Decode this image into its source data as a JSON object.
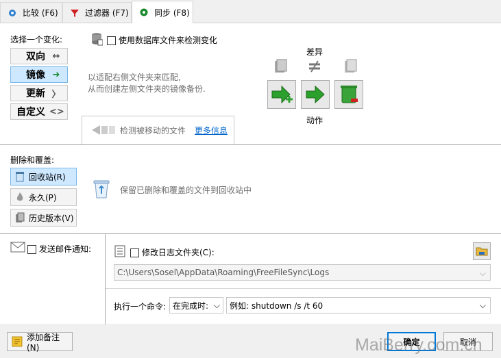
{
  "tabs": [
    {
      "label": "比较 (F6)"
    },
    {
      "label": "过滤器 (F7)"
    },
    {
      "label": "同步 (F8)"
    }
  ],
  "variant": {
    "heading": "选择一个变化:",
    "options": [
      {
        "label": "双向",
        "arrow": "↔"
      },
      {
        "label": "镜像",
        "arrow": "➜"
      },
      {
        "label": "更新",
        "arrow": "〉"
      },
      {
        "label": "自定义",
        "arrow": "<>"
      }
    ],
    "detect_db_label": "使用数据库文件来检测变化",
    "description_line1": "以适配右侧文件夹来匹配,",
    "description_line2": "从而创建左侧文件夹的镜像备份.",
    "detect_moved_label": "检测被移动的文件",
    "more_info_link": "更多信息",
    "diff_label": "差异",
    "action_label": "动作"
  },
  "deletion": {
    "heading": "删除和覆盖:",
    "options": [
      {
        "label": "回收站(R)"
      },
      {
        "label": "永久(P)"
      },
      {
        "label": "历史版本(V)"
      }
    ],
    "description": "保留已删除和覆盖的文件到回收站中"
  },
  "email": {
    "label": "发送邮件通知:"
  },
  "log": {
    "label": "修改日志文件夹(C):",
    "path": "C:\\Users\\Sosel\\AppData\\Roaming\\FreeFileSync\\Logs"
  },
  "command": {
    "label": "执行一个命令:",
    "when": "在完成时:",
    "placeholder": "例如: shutdown /s /t 60"
  },
  "footer": {
    "add_note": "添加备注(N)",
    "ok": "确定",
    "cancel": "取消",
    "watermark": "MaiBerry.com.cn"
  },
  "colors": {
    "accent": "#0078d7",
    "selected_bg": "#cde8ff",
    "green": "#1b8a2e"
  }
}
